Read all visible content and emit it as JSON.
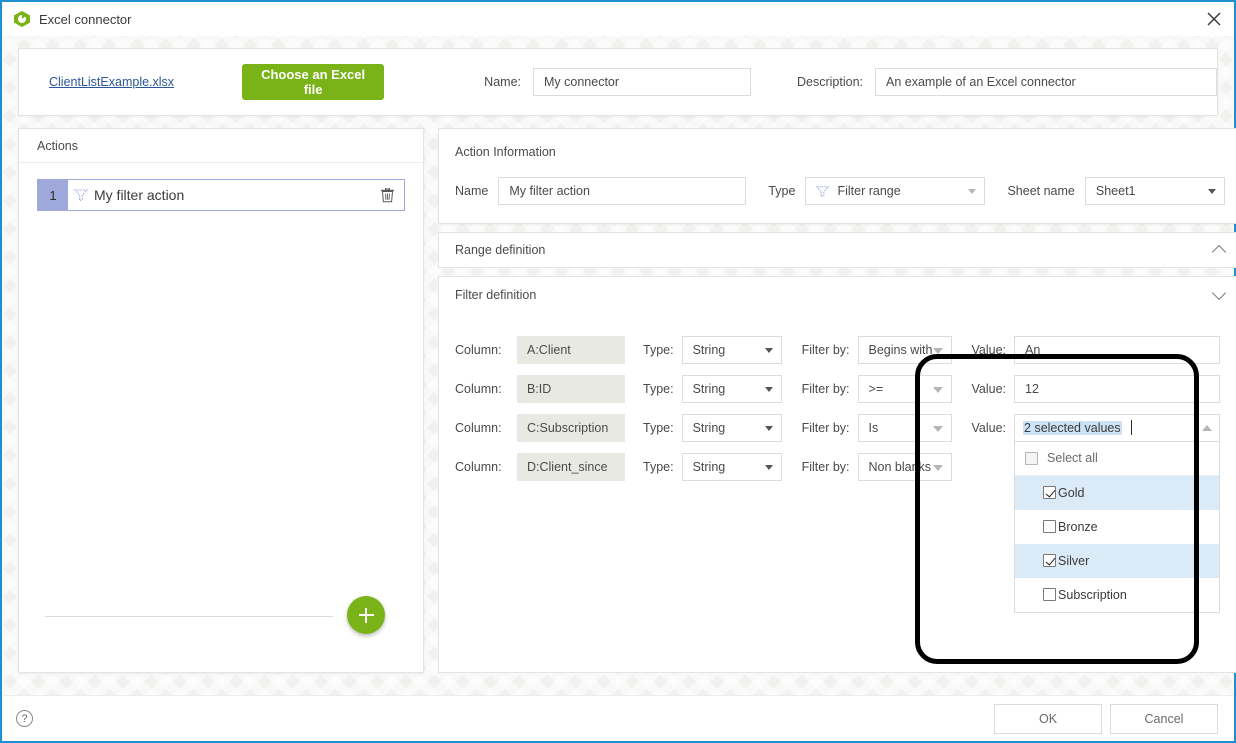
{
  "window": {
    "title": "Excel connector",
    "app_icon": "excel-connector-icon",
    "close_label": "×",
    "accent_border": "#1e90d2"
  },
  "top": {
    "file_link": "ClientListExample.xlsx",
    "choose_button": "Choose an Excel file",
    "choose_button_color": "#7ab317",
    "name_label": "Name:",
    "name_value": "My connector",
    "description_label": "Description:",
    "description_value": "An example of an Excel connector"
  },
  "actions": {
    "panel_title": "Actions",
    "items": [
      {
        "number": "1",
        "icon": "filter-icon",
        "label": "My filter action",
        "delete_icon": "trash-icon"
      }
    ],
    "add_button_icon": "plus-icon",
    "badge_color": "#9fa8da"
  },
  "action_information": {
    "title": "Action Information",
    "name_label": "Name",
    "name_value": "My filter action",
    "type_label": "Type",
    "type_value": "Filter range",
    "type_icon": "filter-icon",
    "sheet_label": "Sheet name",
    "sheet_value": "Sheet1"
  },
  "sections": [
    {
      "title": "Range definition",
      "chevron": "chevron-up-icon",
      "expanded": false
    },
    {
      "title": "Filter definition",
      "chevron": "chevron-down-icon",
      "expanded": true
    }
  ],
  "filter_definition": {
    "labels": {
      "column": "Column:",
      "type": "Type:",
      "filter_by": "Filter by:",
      "value": "Value:"
    },
    "rows": [
      {
        "column": "A:Client",
        "type": "String",
        "filter_by": "Begins with",
        "value": "An",
        "value_kind": "text"
      },
      {
        "column": "B:ID",
        "type": "String",
        "filter_by": ">=",
        "value": "12",
        "value_kind": "text"
      },
      {
        "column": "C:Subscription",
        "type": "String",
        "filter_by": "Is",
        "value": "2 selected values",
        "value_kind": "multiselect"
      },
      {
        "column": "D:Client_since",
        "type": "String",
        "filter_by": "Non blanks",
        "value": "",
        "value_kind": "none"
      }
    ],
    "multiselect": {
      "token_text": "2 selected values",
      "caret_icon": "chevron-up-icon",
      "select_all_label": "Select all",
      "select_all_checked": false,
      "options": [
        {
          "label": "Gold",
          "checked": true
        },
        {
          "label": "Bronze",
          "checked": false
        },
        {
          "label": "Silver",
          "checked": true
        },
        {
          "label": "Subscription",
          "checked": false
        }
      ]
    }
  },
  "footer": {
    "help_icon": "help-icon",
    "help_glyph": "?",
    "ok_label": "OK",
    "cancel_label": "Cancel"
  }
}
